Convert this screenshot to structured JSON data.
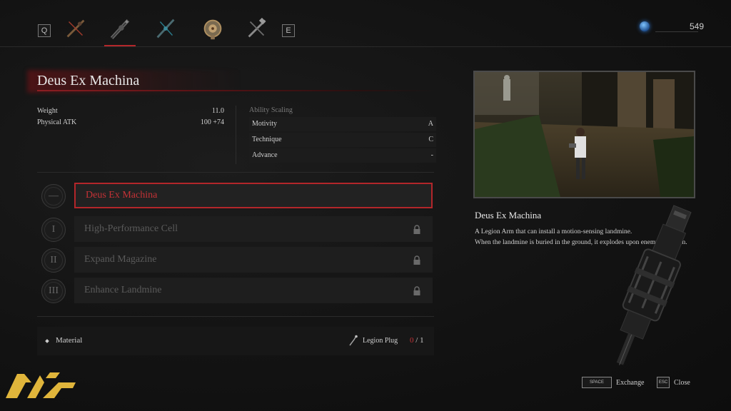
{
  "topbar": {
    "prev_key": "Q",
    "next_key": "E",
    "tabs": [
      {
        "icon": "legion-arm-crossed-icon",
        "active": false
      },
      {
        "icon": "deus-ex-machina-arm-icon",
        "active": true
      },
      {
        "icon": "blue-arm-icon",
        "active": false
      },
      {
        "icon": "round-device-icon",
        "active": false
      },
      {
        "icon": "crossed-tool-icon",
        "active": false
      }
    ],
    "currency_icon": "ergo-gem-icon",
    "currency_amount": "549"
  },
  "item": {
    "name": "Deus Ex Machina",
    "stats": [
      {
        "label": "Weight",
        "value": "11.0"
      },
      {
        "label": "Physical ATK",
        "value": "100 +74"
      }
    ],
    "ability_scaling_label": "Ability Scaling",
    "scaling": [
      {
        "label": "Motivity",
        "grade": "A"
      },
      {
        "label": "Technique",
        "grade": "C"
      },
      {
        "label": "Advance",
        "grade": "-"
      }
    ]
  },
  "upgrades": [
    {
      "numeral": "—",
      "label": "Deus Ex Machina",
      "selected": true,
      "locked": false
    },
    {
      "numeral": "I",
      "label": "High-Performance Cell",
      "selected": false,
      "locked": true
    },
    {
      "numeral": "II",
      "label": "Expand Magazine",
      "selected": false,
      "locked": true
    },
    {
      "numeral": "III",
      "label": "Enhance Landmine",
      "selected": false,
      "locked": true
    }
  ],
  "material": {
    "label": "Material",
    "item_name": "Legion Plug",
    "have": "0",
    "separator": "/",
    "need": "1"
  },
  "preview": {
    "title": "Deus Ex Machina",
    "description_line1": "A Legion Arm that can install a motion-sensing landmine.",
    "description_line2": "When the landmine is buried in the ground, it explodes upon enemy detection."
  },
  "controls": {
    "exchange_key": "SPACE",
    "exchange_label": "Exchange",
    "close_key": "ESC",
    "close_label": "Close"
  },
  "colors": {
    "accent_red": "#b3262a",
    "background": "#141414",
    "logo_gold": "#e0b53b"
  }
}
